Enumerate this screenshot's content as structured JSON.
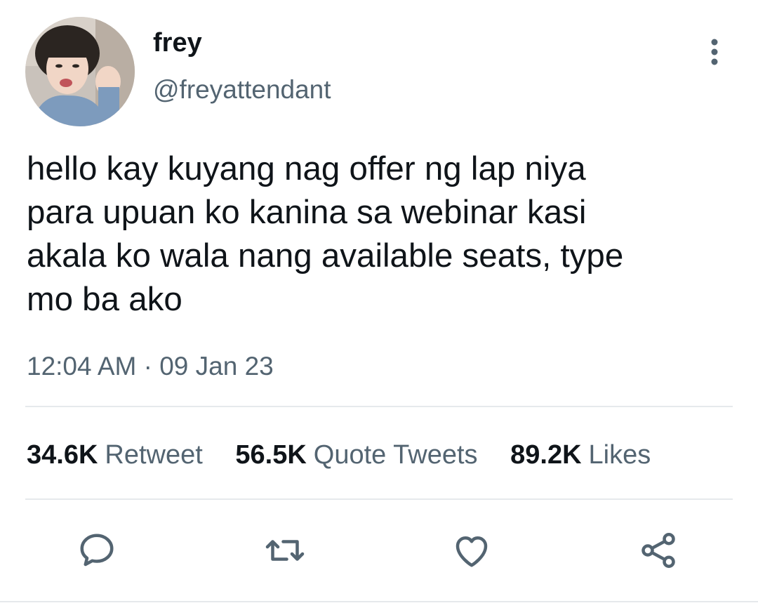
{
  "tweet": {
    "display_name": "frey",
    "handle": "@freyattendant",
    "text_lines": [
      "hello kay kuyang nag offer ng lap niya",
      "para upuan ko kanina sa webinar kasi",
      "akala ko wala nang available seats, type",
      "mo ba ako"
    ],
    "time": "12:04 AM",
    "separator": "·",
    "date": "09 Jan 23"
  },
  "stats": {
    "retweets_count": "34.6K",
    "retweets_label": "Retweet",
    "quotes_count": "56.5K",
    "quotes_label": "Quote Tweets",
    "likes_count": "89.2K",
    "likes_label": "Likes"
  },
  "icons": {
    "more": "more-vertical-icon",
    "reply": "reply-icon",
    "retweet": "retweet-icon",
    "like": "heart-icon",
    "share": "share-icon"
  },
  "colors": {
    "text_primary": "#0f1419",
    "text_secondary": "#536471",
    "divider": "#e6e9ec",
    "icon": "#536471"
  }
}
